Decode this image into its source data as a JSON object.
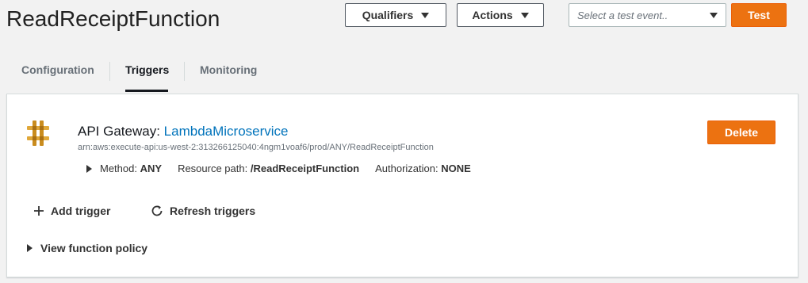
{
  "page": {
    "title": "ReadReceiptFunction"
  },
  "toolbar": {
    "qualifiers_label": "Qualifiers",
    "actions_label": "Actions",
    "test_event_placeholder": "Select a test event..",
    "test_label": "Test"
  },
  "tabs": [
    {
      "label": "Configuration",
      "active": false
    },
    {
      "label": "Triggers",
      "active": true
    },
    {
      "label": "Monitoring",
      "active": false
    }
  ],
  "trigger": {
    "type_label": "API Gateway: ",
    "name": "LambdaMicroservice",
    "arn": "arn:aws:execute-api:us-west-2:313266125040:4ngm1voaf6/prod/ANY/ReadReceiptFunction",
    "method_label": "Method:",
    "method_value": "ANY",
    "resource_path_label": "Resource path:",
    "resource_path_value": "/ReadReceiptFunction",
    "authorization_label": "Authorization:",
    "authorization_value": "NONE",
    "delete_label": "Delete",
    "icon": "api-gateway-icon"
  },
  "panel_actions": {
    "add_trigger_label": "Add trigger",
    "refresh_triggers_label": "Refresh triggers",
    "view_policy_label": "View function policy"
  },
  "colors": {
    "accent_orange": "#ec7211",
    "link_blue": "#0073bb",
    "background": "#f2f2f2",
    "api_gateway_gold": "#c98c1e"
  }
}
